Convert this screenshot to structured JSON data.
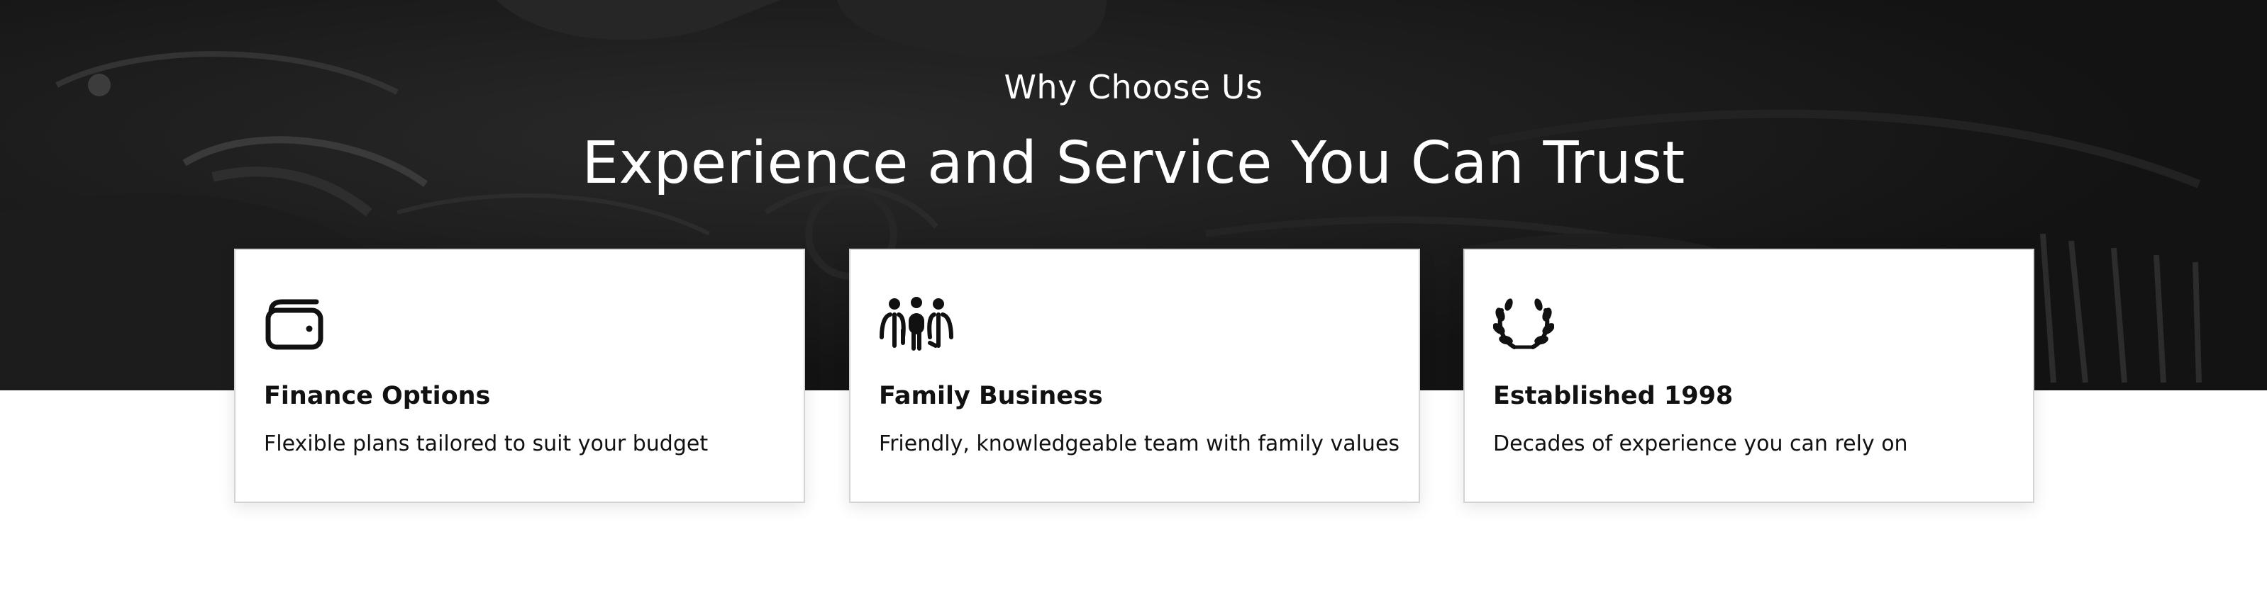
{
  "section": {
    "eyebrow": "Why Choose Us",
    "headline": "Experience and Service You Can Trust"
  },
  "features": [
    {
      "icon": "wallet-icon",
      "title": "Finance Options",
      "description": "Flexible plans tailored to suit your budget"
    },
    {
      "icon": "family-icon",
      "title": "Family Business",
      "description": "Friendly, knowledgeable team with family values"
    },
    {
      "icon": "laurel-wreath-icon",
      "title": "Established 1998",
      "description": "Decades of experience you can rely on"
    }
  ],
  "colors": {
    "hero_background": "#131313",
    "card_background": "#ffffff",
    "text_dark": "#111111",
    "text_light": "#ffffff"
  }
}
